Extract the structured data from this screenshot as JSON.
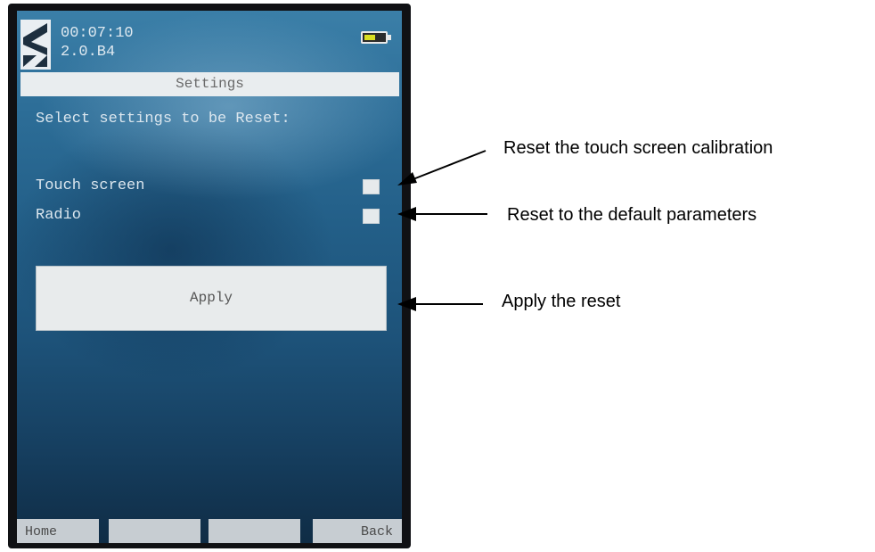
{
  "device": {
    "status": {
      "clock": "00:07:10",
      "version": "2.0.B4",
      "battery_level": 0.55
    },
    "title": "Settings",
    "prompt": "Select settings to be Reset:",
    "options": [
      {
        "label": "Touch screen",
        "checked": false
      },
      {
        "label": "Radio",
        "checked": false
      }
    ],
    "apply_label": "Apply",
    "softkeys": {
      "home": "Home",
      "key2": "",
      "key3": "",
      "back": "Back"
    }
  },
  "annotations": {
    "touch_screen": "Reset the touch screen calibration",
    "radio": "Reset to the default parameters",
    "apply": "Apply the reset"
  },
  "colors": {
    "screen_top": "#3b7fa8",
    "screen_bottom": "#0f2c45",
    "battery_fill": "#d9df22",
    "panel": "#e8ebec"
  }
}
